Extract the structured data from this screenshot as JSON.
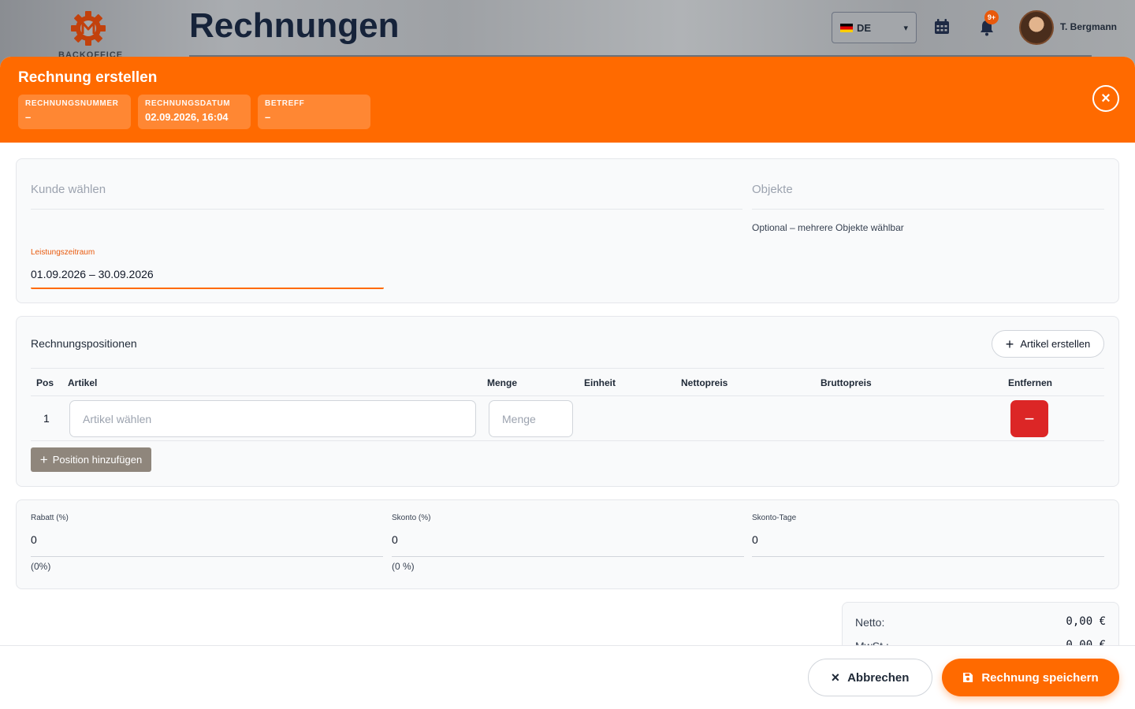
{
  "app": {
    "logo_text": "BACKOFFICE",
    "page_heading": "Rechnungen",
    "language": "DE",
    "notification_count": "9+",
    "user_name": "T. Bergmann"
  },
  "modal": {
    "title": "Rechnung erstellen",
    "info": [
      {
        "label": "RECHNUNGSNUMMER",
        "value": "–"
      },
      {
        "label": "RECHNUNGSDATUM",
        "value": "02.09.2026, 16:04"
      },
      {
        "label": "BETREFF",
        "value": "–"
      }
    ],
    "close_glyph": "×"
  },
  "customer": {
    "customer_placeholder": "Kunde wählen",
    "objects_label": "Objekte",
    "objects_hint": "Optional – mehrere Objekte wählbar",
    "period_label": "Leistungszeitraum",
    "period_value": "01.09.2026 – 30.09.2026"
  },
  "positions": {
    "title": "Rechnungspositionen",
    "create_article_label": "Artikel erstellen",
    "columns": [
      "Pos",
      "Artikel",
      "Menge",
      "Einheit",
      "Nettopreis",
      "Bruttopreis",
      "Entfernen"
    ],
    "rows": [
      {
        "pos": "1",
        "article_placeholder": "Artikel wählen",
        "quantity_placeholder": "Menge"
      }
    ],
    "add_position_label": "Position hinzufügen"
  },
  "discounts": [
    {
      "label": "Rabatt (%)",
      "value": "0",
      "hint": "(0%)"
    },
    {
      "label": "Skonto (%)",
      "value": "0",
      "hint": "(0 %)"
    },
    {
      "label": "Skonto-Tage",
      "value": "0",
      "hint": ""
    }
  ],
  "totals": [
    {
      "label": "Netto:",
      "value": "0,00 €"
    },
    {
      "label": "MwSt.:",
      "value": "0,00 €"
    }
  ],
  "footer": {
    "cancel_label": "Abbrechen",
    "save_label": "Rechnung speichern"
  },
  "colors": {
    "accent": "#ff6a00",
    "danger": "#dc2626",
    "neutral_button": "#8f867c"
  }
}
